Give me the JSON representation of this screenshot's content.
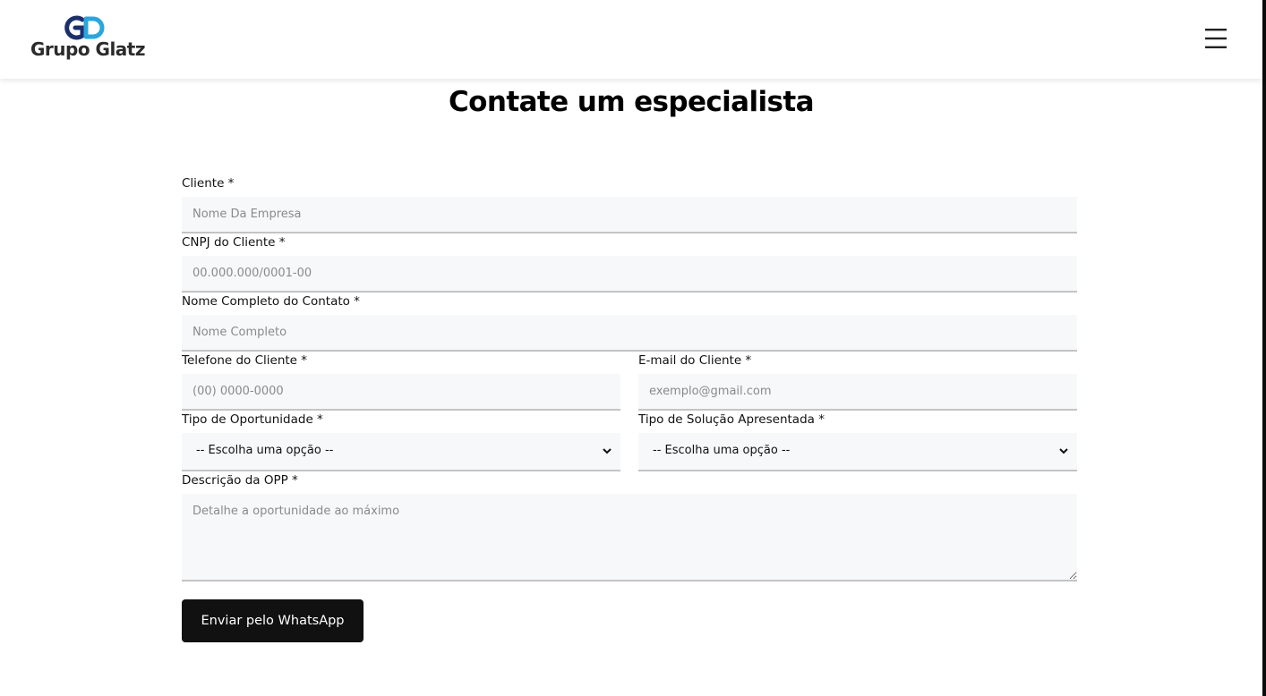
{
  "header": {
    "logo_text": "Grupo Glatz",
    "logo_mark_colors": {
      "dark": "#1d2f6b",
      "light": "#2aa6dc"
    },
    "menu_icon": "hamburger-icon"
  },
  "page_title": "Contate um especialista",
  "form": {
    "cliente": {
      "label": "Cliente *",
      "placeholder": "Nome Da Empresa",
      "value": ""
    },
    "cnpj": {
      "label": "CNPJ do Cliente *",
      "placeholder": "00.000.000/0001-00",
      "value": ""
    },
    "nome_contato": {
      "label": "Nome Completo do Contato *",
      "placeholder": "Nome Completo",
      "value": ""
    },
    "telefone": {
      "label": "Telefone do Cliente *",
      "placeholder": "(00) 0000-0000",
      "value": ""
    },
    "email": {
      "label": "E-mail do Cliente *",
      "placeholder": "exemplo@gmail.com",
      "value": ""
    },
    "tipo_oportunidade": {
      "label": "Tipo de Oportunidade *",
      "selected": "-- Escolha uma opção --"
    },
    "tipo_solucao": {
      "label": "Tipo de Solução Apresentada *",
      "selected": "-- Escolha uma opção --"
    },
    "descricao": {
      "label": "Descrição da OPP *",
      "placeholder": "Detalhe a oportunidade ao máximo",
      "value": ""
    },
    "submit_label": "Enviar pelo WhatsApp"
  },
  "colors": {
    "input_bg": "#f7f8fa",
    "input_border": "#c4c4c4",
    "button_bg": "#111111",
    "button_text": "#ffffff"
  }
}
